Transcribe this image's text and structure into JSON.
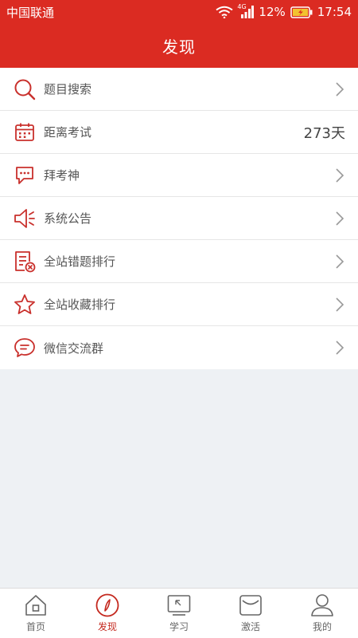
{
  "status_bar": {
    "carrier": "中国联通",
    "network": "4G",
    "battery": "12%",
    "time": "17:54"
  },
  "header": {
    "title": "发现"
  },
  "colors": {
    "brand_red": "#db2b22",
    "icon_red": "#c9302c",
    "background": "#eef1f4"
  },
  "menu": {
    "items": [
      {
        "label": "题目搜索",
        "icon": "search-icon",
        "value": ""
      },
      {
        "label": "距离考试",
        "icon": "calendar-icon",
        "value": "273天"
      },
      {
        "label": "拜考神",
        "icon": "chat-bubble-icon",
        "value": ""
      },
      {
        "label": "系统公告",
        "icon": "speaker-icon",
        "value": ""
      },
      {
        "label": "全站错题排行",
        "icon": "wrong-list-icon",
        "value": ""
      },
      {
        "label": "全站收藏排行",
        "icon": "star-icon",
        "value": ""
      },
      {
        "label": "微信交流群",
        "icon": "wechat-bubble-icon",
        "value": ""
      }
    ]
  },
  "tabbar": {
    "tabs": [
      {
        "label": "首页",
        "icon": "home-icon",
        "active": false
      },
      {
        "label": "发现",
        "icon": "compass-icon",
        "active": true
      },
      {
        "label": "学习",
        "icon": "monitor-icon",
        "active": false
      },
      {
        "label": "激活",
        "icon": "envelope-icon",
        "active": false
      },
      {
        "label": "我的",
        "icon": "user-icon",
        "active": false
      }
    ]
  }
}
